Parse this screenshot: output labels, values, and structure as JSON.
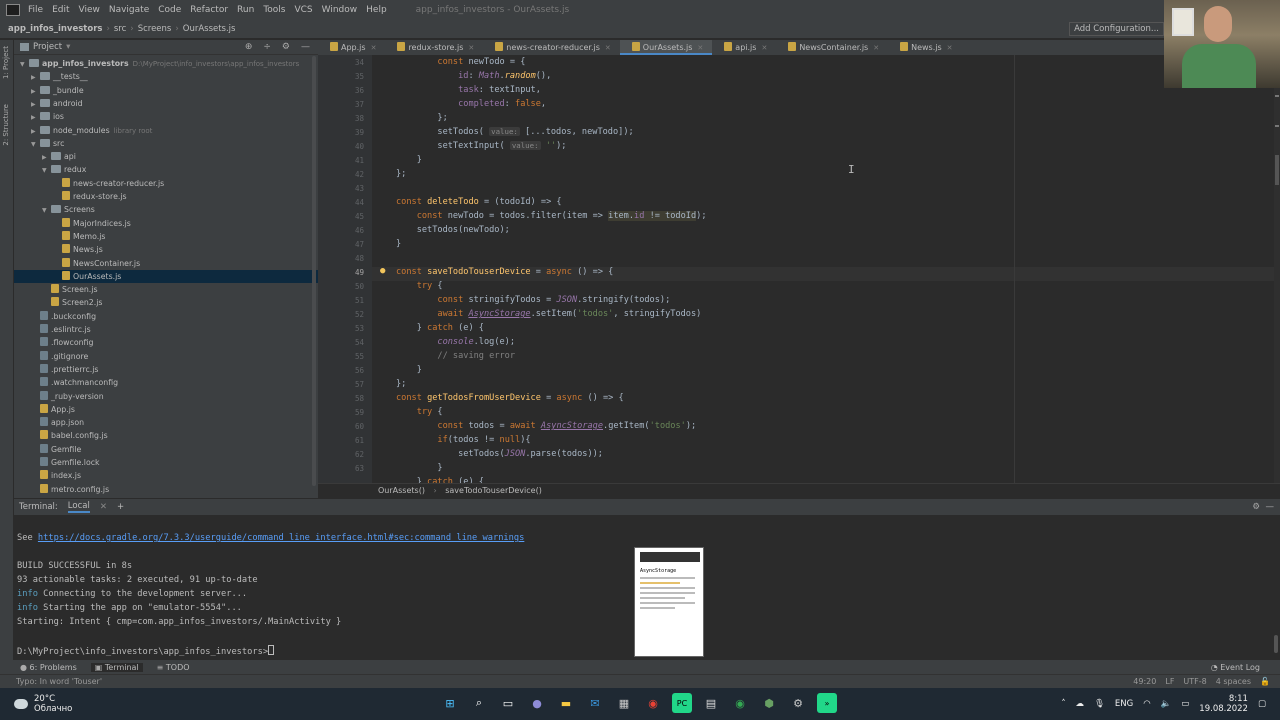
{
  "menu": {
    "items": [
      "File",
      "Edit",
      "View",
      "Navigate",
      "Code",
      "Refactor",
      "Run",
      "Tools",
      "VCS",
      "Window",
      "Help"
    ],
    "window_title": "app_infos_investors - OurAssets.js"
  },
  "navbar": {
    "crumbs": [
      "app_infos_investors",
      "src",
      "Screens",
      "OurAssets.js"
    ],
    "add_configuration": "Add Configuration..."
  },
  "left_strip": [
    "1: Project",
    "2: Structure"
  ],
  "project_panel": {
    "title": "Project",
    "icons": [
      "target-icon",
      "equalize-icon",
      "gear-icon",
      "minimize-icon"
    ],
    "tree": [
      {
        "depth": 0,
        "arrow": "▼",
        "type": "folder",
        "label": "app_infos_investors",
        "hint": "D:\\MyProject\\info_investors\\app_infos_investors"
      },
      {
        "depth": 1,
        "arrow": "▶",
        "type": "folder",
        "label": "__tests__",
        "hint": ""
      },
      {
        "depth": 1,
        "arrow": "▶",
        "type": "folder",
        "label": "_bundle",
        "hint": ""
      },
      {
        "depth": 1,
        "arrow": "▶",
        "type": "folder",
        "label": "android",
        "hint": ""
      },
      {
        "depth": 1,
        "arrow": "▶",
        "type": "folder",
        "label": "ios",
        "hint": ""
      },
      {
        "depth": 1,
        "arrow": "▶",
        "type": "folder",
        "label": "node_modules",
        "hint": "library root"
      },
      {
        "depth": 1,
        "arrow": "▼",
        "type": "folder",
        "label": "src",
        "hint": ""
      },
      {
        "depth": 2,
        "arrow": "▶",
        "type": "folder",
        "label": "api",
        "hint": ""
      },
      {
        "depth": 2,
        "arrow": "▼",
        "type": "folder",
        "label": "redux",
        "hint": ""
      },
      {
        "depth": 3,
        "arrow": "",
        "type": "js",
        "label": "news-creator-reducer.js",
        "hint": ""
      },
      {
        "depth": 3,
        "arrow": "",
        "type": "js",
        "label": "redux-store.js",
        "hint": ""
      },
      {
        "depth": 2,
        "arrow": "▼",
        "type": "folder",
        "label": "Screens",
        "hint": ""
      },
      {
        "depth": 3,
        "arrow": "",
        "type": "js",
        "label": "MajorIndices.js",
        "hint": ""
      },
      {
        "depth": 3,
        "arrow": "",
        "type": "js",
        "label": "Memo.js",
        "hint": ""
      },
      {
        "depth": 3,
        "arrow": "",
        "type": "js",
        "label": "News.js",
        "hint": ""
      },
      {
        "depth": 3,
        "arrow": "",
        "type": "js",
        "label": "NewsContainer.js",
        "hint": ""
      },
      {
        "depth": 3,
        "arrow": "",
        "type": "js",
        "label": "OurAssets.js",
        "hint": "",
        "selected": true
      },
      {
        "depth": 2,
        "arrow": "",
        "type": "js",
        "label": "Screen.js",
        "hint": ""
      },
      {
        "depth": 2,
        "arrow": "",
        "type": "js",
        "label": "Screen2.js",
        "hint": ""
      },
      {
        "depth": 1,
        "arrow": "",
        "type": "cfg",
        "label": ".buckconfig",
        "hint": ""
      },
      {
        "depth": 1,
        "arrow": "",
        "type": "cfg",
        "label": ".eslintrc.js",
        "hint": ""
      },
      {
        "depth": 1,
        "arrow": "",
        "type": "cfg",
        "label": ".flowconfig",
        "hint": ""
      },
      {
        "depth": 1,
        "arrow": "",
        "type": "cfg",
        "label": ".gitignore",
        "hint": ""
      },
      {
        "depth": 1,
        "arrow": "",
        "type": "cfg",
        "label": ".prettierrc.js",
        "hint": ""
      },
      {
        "depth": 1,
        "arrow": "",
        "type": "cfg",
        "label": ".watchmanconfig",
        "hint": ""
      },
      {
        "depth": 1,
        "arrow": "",
        "type": "cfg",
        "label": "_ruby-version",
        "hint": ""
      },
      {
        "depth": 1,
        "arrow": "",
        "type": "js",
        "label": "App.js",
        "hint": ""
      },
      {
        "depth": 1,
        "arrow": "",
        "type": "cfg",
        "label": "app.json",
        "hint": ""
      },
      {
        "depth": 1,
        "arrow": "",
        "type": "js",
        "label": "babel.config.js",
        "hint": ""
      },
      {
        "depth": 1,
        "arrow": "",
        "type": "cfg",
        "label": "Gemfile",
        "hint": ""
      },
      {
        "depth": 1,
        "arrow": "",
        "type": "cfg",
        "label": "Gemfile.lock",
        "hint": ""
      },
      {
        "depth": 1,
        "arrow": "",
        "type": "js",
        "label": "index.js",
        "hint": ""
      },
      {
        "depth": 1,
        "arrow": "",
        "type": "js",
        "label": "metro.config.js",
        "hint": ""
      }
    ]
  },
  "editor_tabs": [
    "App.js",
    "redux-store.js",
    "news-creator-reducer.js",
    "OurAssets.js",
    "api.js",
    "NewsContainer.js",
    "News.js"
  ],
  "active_tab": "OurAssets.js",
  "line_numbers": [
    "34",
    "35",
    "36",
    "37",
    "38",
    "39",
    "40",
    "41",
    "42",
    "43",
    "44",
    "45",
    "46",
    "47",
    "48",
    "49",
    "50",
    "51",
    "52",
    "53",
    "54",
    "55",
    "56",
    "57",
    "58",
    "59",
    "60",
    "61",
    "62",
    "63"
  ],
  "editor_breadcrumb": [
    "OurAssets()",
    "saveTodoTouserDevice()"
  ],
  "terminal": {
    "title": "Terminal:",
    "tab": "Local",
    "add": "+",
    "see_prefix": "See ",
    "link": "https://docs.gradle.org/7.3.3/userguide/command_line_interface.html#sec:command_line_warnings",
    "build": "BUILD SUCCESSFUL in 8s",
    "tasks": "93 actionable tasks: 2 executed, 91 up-to-date",
    "info_word": "info",
    "info1": " Connecting to the development server...",
    "info2": " Starting the app on \"emulator-5554\"...",
    "starting": "Starting: Intent { cmp=com.app_infos_investors/.MainActivity }",
    "prompt": "D:\\MyProject\\info_investors\\app_infos_investors>"
  },
  "thumbnail": {
    "title": "AsyncStorage"
  },
  "bottom_tabs": [
    "6: Problems",
    "Terminal",
    "TODO"
  ],
  "event_log": "Event Log",
  "status": {
    "message": "Typo: In word 'Touser'",
    "position": "49:20",
    "line_sep": "LF",
    "encoding": "UTF-8",
    "indent": "4 spaces"
  },
  "taskbar": {
    "temperature": "20°C",
    "weather": "Облачно",
    "lang": "ENG",
    "time": "8:11",
    "date": "19.08.2022"
  }
}
